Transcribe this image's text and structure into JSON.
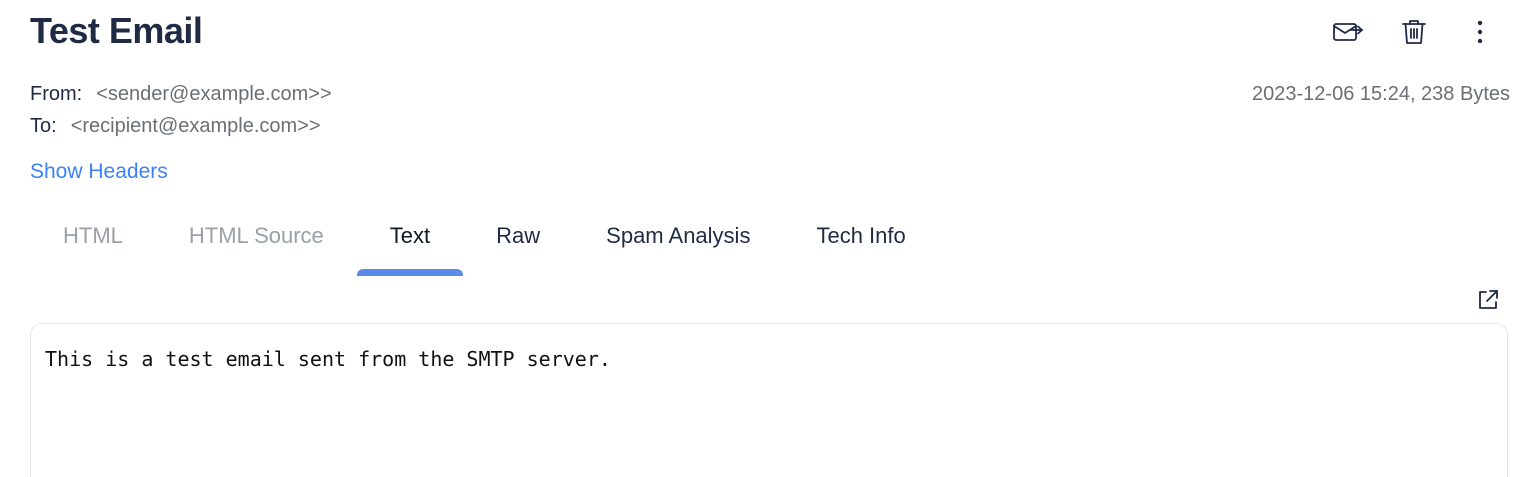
{
  "email": {
    "subject": "Test Email",
    "from_label": "From:",
    "from_value": "<sender@example.com>>",
    "to_label": "To:",
    "to_value": "<recipient@example.com>>",
    "date_size": "2023-12-06 15:24, 238 Bytes",
    "show_headers": "Show Headers",
    "body_text": "This is a test email sent from the SMTP server."
  },
  "actions": {
    "icons": [
      "forward-mail-icon",
      "trash-icon",
      "more-vertical-icon"
    ]
  },
  "tabs": [
    {
      "label": "HTML",
      "state": "disabled"
    },
    {
      "label": "HTML Source",
      "state": "disabled"
    },
    {
      "label": "Text",
      "state": "active"
    },
    {
      "label": "Raw",
      "state": "normal"
    },
    {
      "label": "Spam Analysis",
      "state": "normal"
    },
    {
      "label": "Tech Info",
      "state": "normal"
    }
  ],
  "colors": {
    "title": "#1f2a44",
    "link": "#3b82f6",
    "tab_indicator": "#5b8be8",
    "muted": "#6b6f73",
    "disabled_tab": "#9aa0a8"
  }
}
